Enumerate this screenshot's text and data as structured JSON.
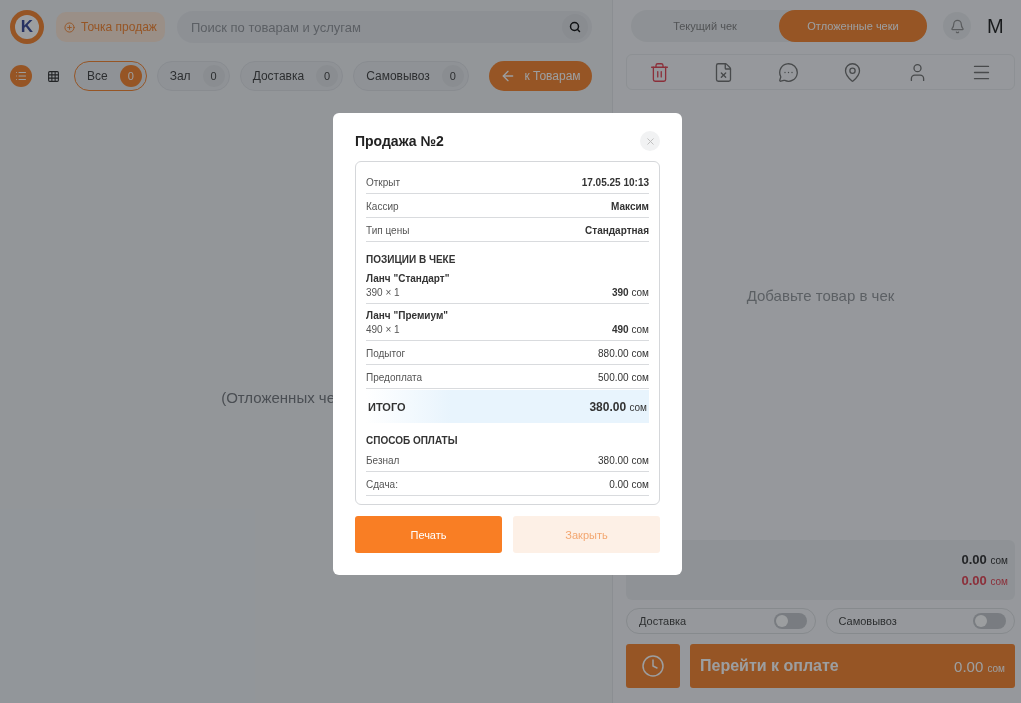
{
  "header": {
    "logo": {
      "letter": "K"
    },
    "point_of_sale": {
      "label": "Точка продаж"
    },
    "search": {
      "placeholder": "Поиск по товарам и услугам"
    }
  },
  "view_toggles": [
    {
      "kind": "list",
      "selected": true
    },
    {
      "kind": "grid",
      "selected": false
    }
  ],
  "filters": [
    {
      "label": "Все",
      "count": "0",
      "selected": true
    },
    {
      "label": "Зал",
      "count": "0",
      "selected": false
    },
    {
      "label": "Доставка",
      "count": "0",
      "selected": false
    },
    {
      "label": "Самовывоз",
      "count": "0",
      "selected": false
    }
  ],
  "back_button": {
    "label": "к Товарам"
  },
  "left_empty": {
    "text": "(Отложенных че"
  },
  "receipt_tabs": [
    {
      "label": "Текущий чек",
      "selected": false
    },
    {
      "label": "Отложенные чеки",
      "selected": true
    }
  ],
  "user": {
    "initial": "M"
  },
  "toolbar": [
    {
      "kind": "trash"
    },
    {
      "kind": "excel"
    },
    {
      "kind": "comment"
    },
    {
      "kind": "location"
    },
    {
      "kind": "user"
    },
    {
      "kind": "menu"
    }
  ],
  "right_empty": {
    "text": "Добавьте товар в чек"
  },
  "summary": [
    {
      "value": "0.00",
      "currency": "сом",
      "kind": "normal"
    },
    {
      "value": "0.00",
      "currency": "сом",
      "kind": "negative"
    }
  ],
  "switches": [
    {
      "label": "Доставка",
      "on": false
    },
    {
      "label": "Самовывоз",
      "on": false
    }
  ],
  "pay_button": {
    "label": "Перейти к оплате",
    "value": "0.00",
    "currency": "сом"
  },
  "modal": {
    "title": "Продажа №2",
    "info": [
      {
        "label": "Открыт",
        "value": "17.05.25 10:13"
      },
      {
        "label": "Кассир",
        "value": "Максим"
      },
      {
        "label": "Тип цены",
        "value": "Стандартная"
      }
    ],
    "items_title": "ПОЗИЦИИ В ЧЕКЕ",
    "items": [
      {
        "name": "Ланч \"Стандарт\"",
        "qty": "390 × 1",
        "amount": "390",
        "currency": "сом"
      },
      {
        "name": "Ланч \"Премиум\"",
        "qty": "490 × 1",
        "amount": "490",
        "currency": "сом"
      }
    ],
    "totals": [
      {
        "label": "Подытог",
        "value": "880.00",
        "currency": "сом"
      },
      {
        "label": "Предоплата",
        "value": "500.00",
        "currency": "сом"
      }
    ],
    "grand_total": {
      "label": "ИТОГО",
      "value": "380.00",
      "currency": "сом"
    },
    "payment_title": "СПОСОБ ОПЛАТЫ",
    "payments": [
      {
        "label": "Безнал",
        "value": "380.00",
        "currency": "сом"
      },
      {
        "label": "Сдача:",
        "value": "0.00",
        "currency": "сом"
      }
    ],
    "buttons": [
      {
        "label": "Печать",
        "kind": "primary"
      },
      {
        "label": "Закрыть",
        "kind": "secondary"
      }
    ]
  }
}
